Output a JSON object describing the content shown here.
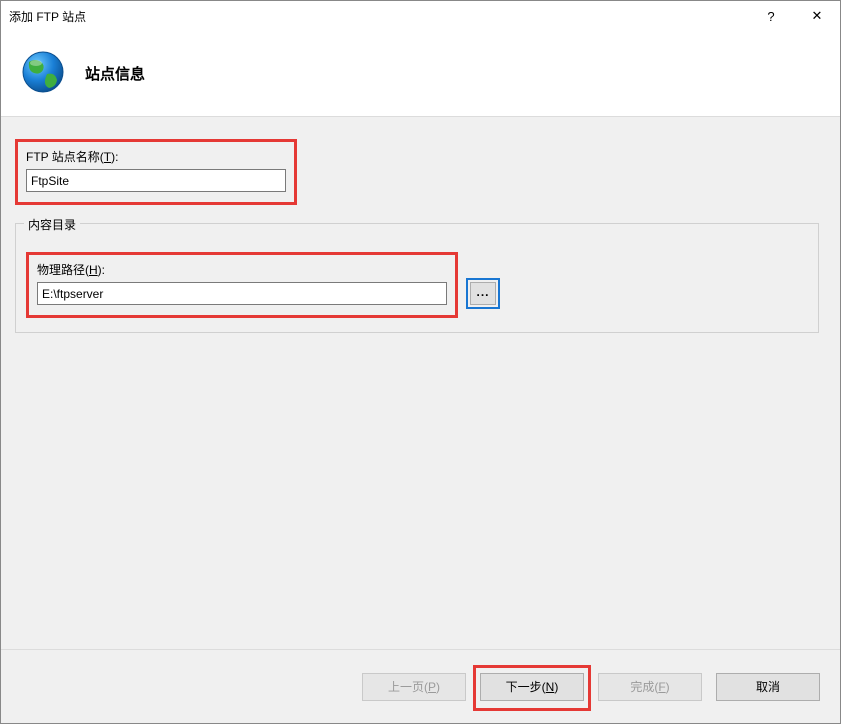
{
  "window": {
    "title": "添加 FTP 站点",
    "help_btn": "?",
    "close_btn": "✕"
  },
  "header": {
    "heading": "站点信息"
  },
  "form": {
    "site_name_label_prefix": "FTP 站点名称(",
    "site_name_label_key": "T",
    "site_name_label_suffix": "):",
    "site_name_value": "FtpSite",
    "content_dir_legend": "内容目录",
    "physical_path_label_prefix": "物理路径(",
    "physical_path_label_key": "H",
    "physical_path_label_suffix": "):",
    "physical_path_value": "E:\\ftpserver",
    "browse_label": "..."
  },
  "footer": {
    "prev_prefix": "上一页(",
    "prev_key": "P",
    "prev_suffix": ")",
    "next_prefix": "下一步(",
    "next_key": "N",
    "next_suffix": ")",
    "finish_prefix": "完成(",
    "finish_key": "F",
    "finish_suffix": ")",
    "cancel": "取消"
  }
}
